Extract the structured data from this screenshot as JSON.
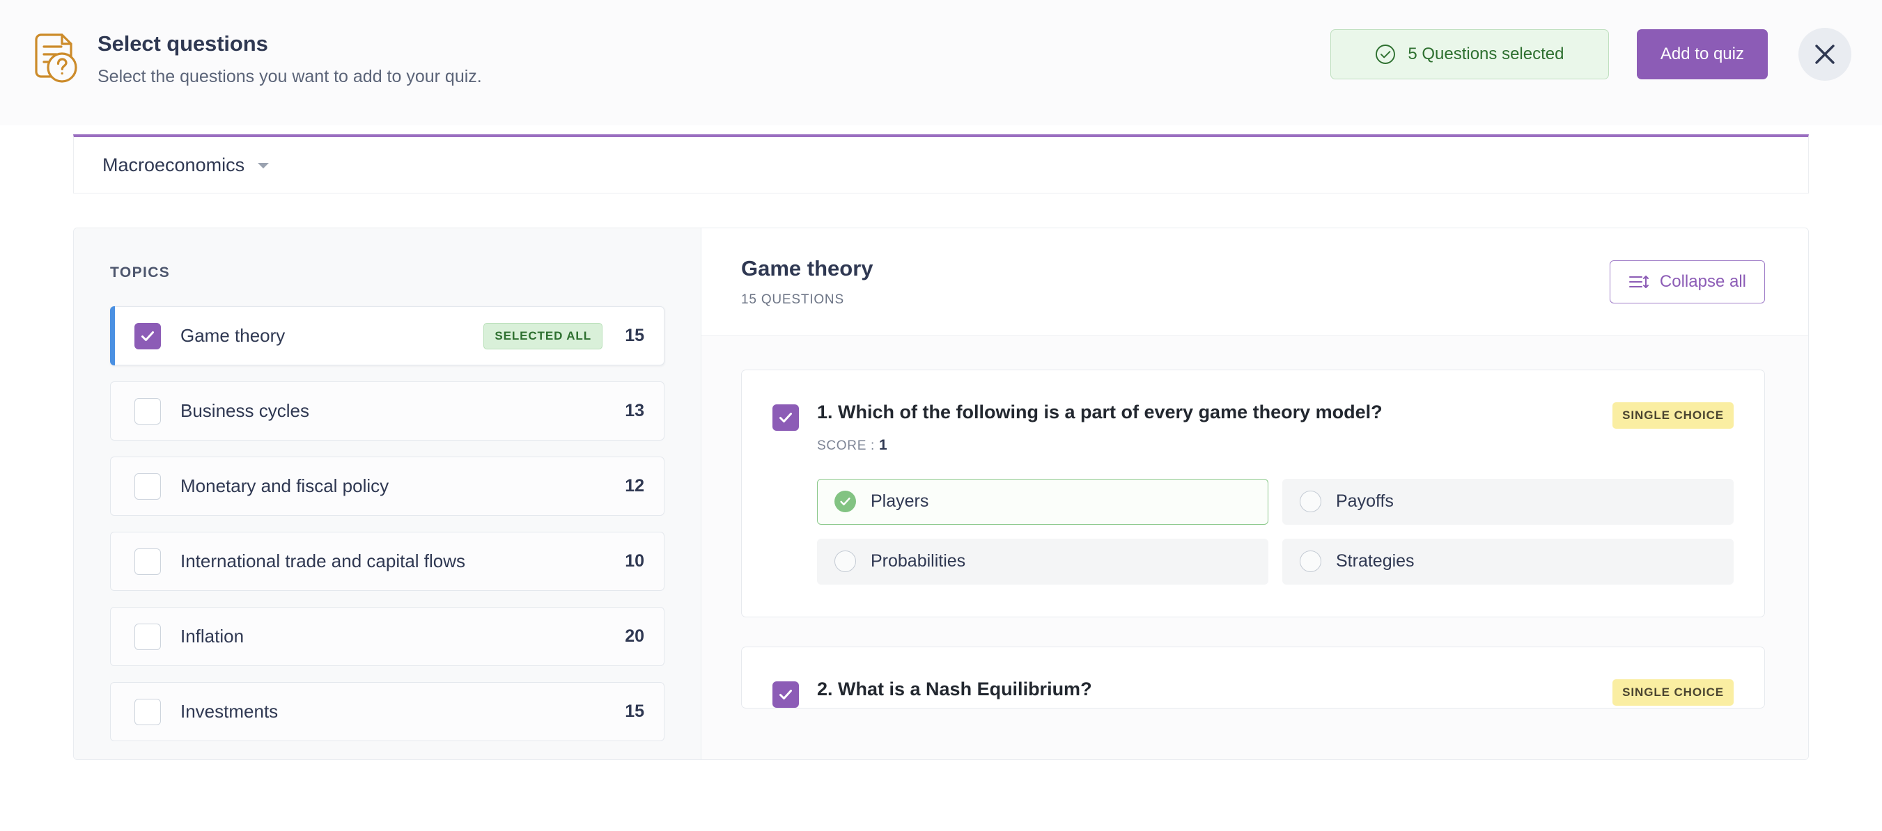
{
  "header": {
    "icon": "document-question-icon",
    "title": "Select questions",
    "subtitle": "Select the questions you want to add to your quiz.",
    "selected_pill": {
      "icon": "check-circle-icon",
      "label": "5 Questions selected"
    },
    "add_button": "Add to quiz",
    "close_button": "close-icon"
  },
  "subject": {
    "label": "Macroeconomics",
    "caret": "chevron-down-icon"
  },
  "sidebar": {
    "section_label": "TOPICS",
    "topics": [
      {
        "name": "Game theory",
        "count": "15",
        "checked": true,
        "active": true,
        "badge": "SELECTED ALL"
      },
      {
        "name": "Business cycles",
        "count": "13",
        "checked": false,
        "active": false,
        "badge": ""
      },
      {
        "name": "Monetary and fiscal policy",
        "count": "12",
        "checked": false,
        "active": false,
        "badge": ""
      },
      {
        "name": "International trade and capital flows",
        "count": "10",
        "checked": false,
        "active": false,
        "badge": ""
      },
      {
        "name": "Inflation",
        "count": "20",
        "checked": false,
        "active": false,
        "badge": ""
      },
      {
        "name": "Investments",
        "count": "15",
        "checked": false,
        "active": false,
        "badge": ""
      }
    ]
  },
  "content": {
    "title": "Game theory",
    "subtitle": "15 QUESTIONS",
    "collapse_button": "Collapse all",
    "collapse_icon": "collapse-list-icon",
    "questions": [
      {
        "text": "1. Which of the following is a part of every game theory model?",
        "score_label": "SCORE :",
        "score_value": "1",
        "type_badge": "SINGLE CHOICE",
        "checked": true,
        "options": [
          {
            "label": "Players",
            "correct": true
          },
          {
            "label": "Payoffs",
            "correct": false
          },
          {
            "label": "Probabilities",
            "correct": false
          },
          {
            "label": "Strategies",
            "correct": false
          }
        ]
      },
      {
        "text": "2. What is a Nash Equilibrium?",
        "type_badge": "SINGLE CHOICE",
        "checked": true
      }
    ]
  },
  "colors": {
    "purple": "#8c5cb6",
    "purple_border": "#9a6ec0",
    "blue_accent": "#4a90e2",
    "green_text": "#2e7030",
    "green_pill_bg": "#eaf7ea",
    "green_badge_bg": "#d9f0d9",
    "yellow_badge_bg": "#faeea2",
    "orange_icon": "#cc8b2a",
    "text_dark": "#2f3852",
    "panel_bg": "#f8f9fa"
  }
}
